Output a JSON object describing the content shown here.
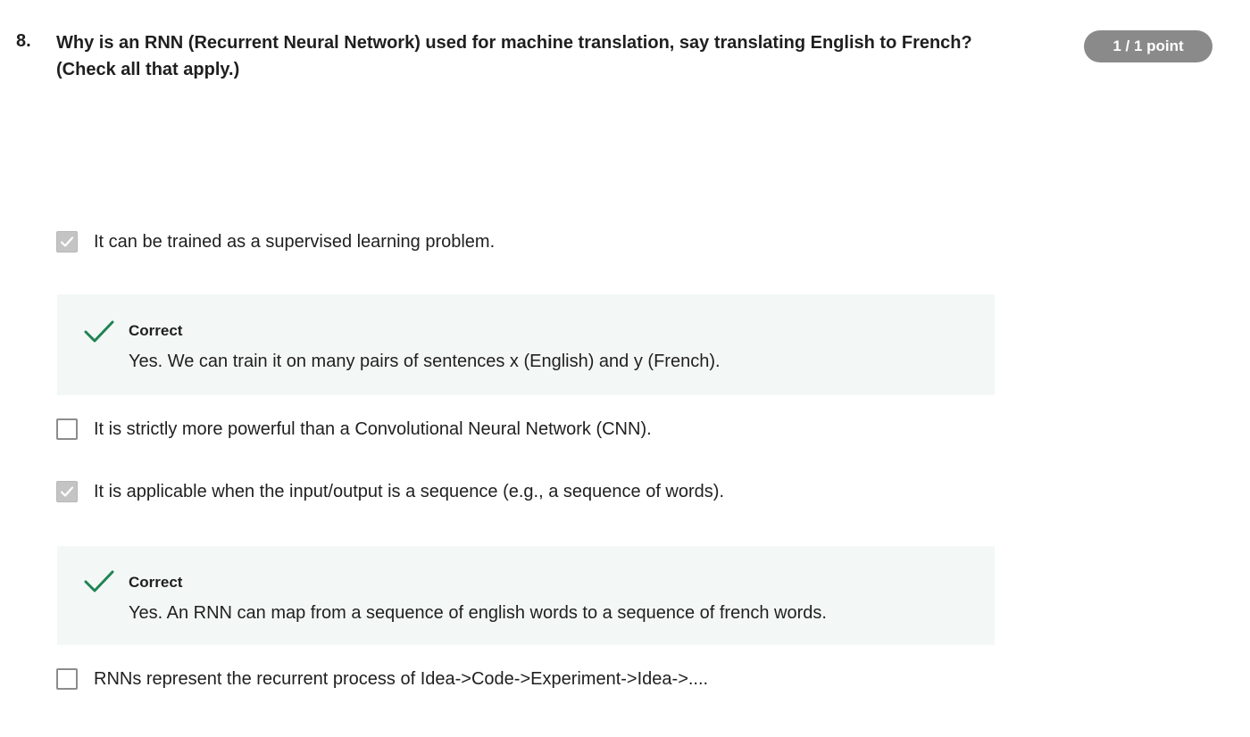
{
  "question": {
    "number": "8.",
    "text": "Why is an RNN (Recurrent Neural Network) used for machine translation, say translating English to French? (Check all that apply.)",
    "points": "1 / 1 point"
  },
  "options": [
    {
      "label": "It can be trained as a supervised learning problem.",
      "checked": true,
      "feedback": {
        "title": "Correct",
        "text": "Yes. We can train it on many pairs of sentences x (English) and y (French)."
      }
    },
    {
      "label": "It is strictly more powerful than a Convolutional Neural Network (CNN).",
      "checked": false
    },
    {
      "label": "It is applicable when the input/output is a sequence (e.g., a sequence of words).",
      "checked": true,
      "feedback": {
        "title": "Correct",
        "text": "Yes. An RNN can map from a sequence of english words to a sequence of french words."
      }
    },
    {
      "label": "RNNs represent the recurrent process of Idea->Code->Experiment->Idea->....",
      "checked": false
    }
  ],
  "colors": {
    "badge_background": "#8a8a8a",
    "feedback_background": "#f3f8f6",
    "correct_check": "#1f8354",
    "checkbox_checked": "#c4c4c4",
    "checkbox_border": "#8c8c8c"
  },
  "icons": {
    "checkbox_checkmark": "check-icon",
    "feedback_checkmark": "checkmark-icon"
  }
}
